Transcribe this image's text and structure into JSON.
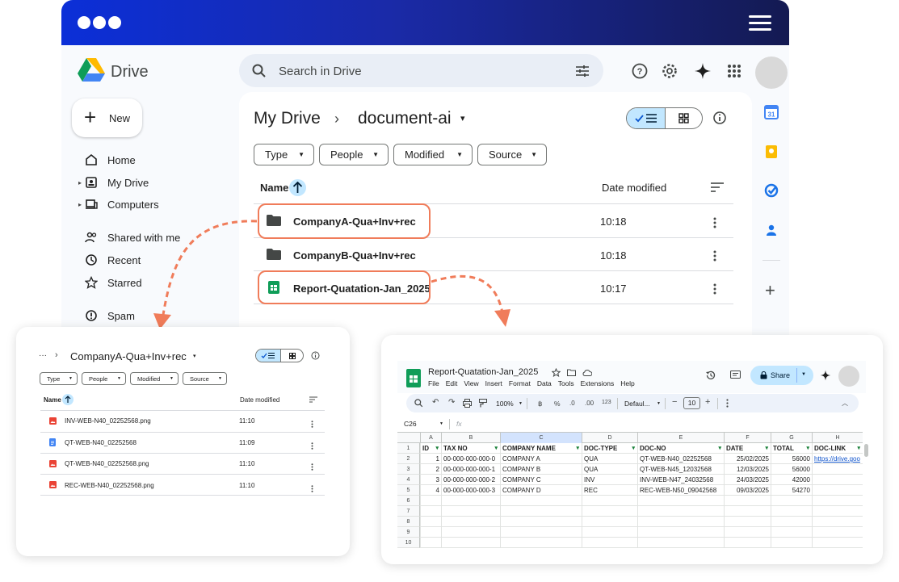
{
  "drive": {
    "app_name": "Drive",
    "search_placeholder": "Search in Drive",
    "new_label": "New",
    "nav": [
      {
        "label": "Home"
      },
      {
        "label": "My Drive"
      },
      {
        "label": "Computers"
      },
      {
        "label": "Shared with me"
      },
      {
        "label": "Recent"
      },
      {
        "label": "Starred"
      },
      {
        "label": "Spam"
      }
    ],
    "breadcrumb": {
      "root": "My Drive",
      "sep": "›",
      "current": "document-ai",
      "caret": "▾"
    },
    "filters": [
      "Type",
      "People",
      "Modified",
      "Source"
    ],
    "columns": {
      "name": "Name",
      "date": "Date modified"
    },
    "files": [
      {
        "name": "CompanyA-Qua+Inv+rec",
        "date": "10:18",
        "kind": "folder"
      },
      {
        "name": "CompanyB-Qua+Inv+rec",
        "date": "10:18",
        "kind": "folder"
      },
      {
        "name": "Report-Quatation-Jan_2025",
        "date": "10:17",
        "kind": "sheet"
      }
    ]
  },
  "folder_view": {
    "ellipsis": "···",
    "sep": "›",
    "title": "CompanyA-Qua+Inv+rec",
    "caret": "▾",
    "filters": [
      "Type",
      "People",
      "Modified",
      "Source"
    ],
    "columns": {
      "name": "Name",
      "date": "Date modified"
    },
    "files": [
      {
        "name": "INV-WEB-N40_02252568.png",
        "date": "11:10",
        "kind": "image"
      },
      {
        "name": "QT-WEB-N40_02252568",
        "date": "11:09",
        "kind": "doc"
      },
      {
        "name": "QT-WEB-N40_02252568.png",
        "date": "11:10",
        "kind": "image"
      },
      {
        "name": "REC-WEB-N40_02252568.png",
        "date": "11:10",
        "kind": "image"
      }
    ]
  },
  "sheet": {
    "title": "Report-Quatation-Jan_2025",
    "menu": [
      "File",
      "Edit",
      "View",
      "Insert",
      "Format",
      "Data",
      "Tools",
      "Extensions",
      "Help"
    ],
    "share_label": "Share",
    "zoom": "100%",
    "font": "Defaul...",
    "font_size": "10",
    "toolbar_text": {
      "currency": "฿",
      "percent": "%",
      "dec_less": ".0",
      "dec_more": ".00",
      "num": "123"
    },
    "name_box": "C26",
    "fx": "fx",
    "col_letters": [
      "A",
      "B",
      "C",
      "D",
      "E",
      "F",
      "G",
      "H"
    ],
    "row_numbers": [
      "1",
      "2",
      "3",
      "4",
      "5",
      "6",
      "7",
      "8",
      "9",
      "10"
    ],
    "headers": [
      "ID",
      "TAX NO",
      "COMPANY NAME",
      "DOC-TYPE",
      "DOC-NO",
      "DATE",
      "TOTAL",
      "DOC-LINK"
    ],
    "rows": [
      [
        "1",
        "00-000-000-000-0",
        "COMPANY A",
        "QUA",
        "QT-WEB-N40_02252568",
        "25/02/2025",
        "56000",
        "https://drive.goo"
      ],
      [
        "2",
        "00-000-000-000-1",
        "COMPANY B",
        "QUA",
        "QT-WEB-N45_12032568",
        "12/03/2025",
        "56000",
        ""
      ],
      [
        "3",
        "00-000-000-000-2",
        "COMPANY C",
        "INV",
        "INV-WEB-N47_24032568",
        "24/03/2025",
        "42000",
        ""
      ],
      [
        "4",
        "00-000-000-000-3",
        "COMPANY D",
        "REC",
        "REC-WEB-N50_09042568",
        "09/03/2025",
        "54270",
        ""
      ]
    ]
  },
  "colors": {
    "accent": "#0b57d0",
    "highlight": "#f07c5a",
    "selected": "#c2e7ff",
    "sheet_green": "#0f9d58"
  }
}
